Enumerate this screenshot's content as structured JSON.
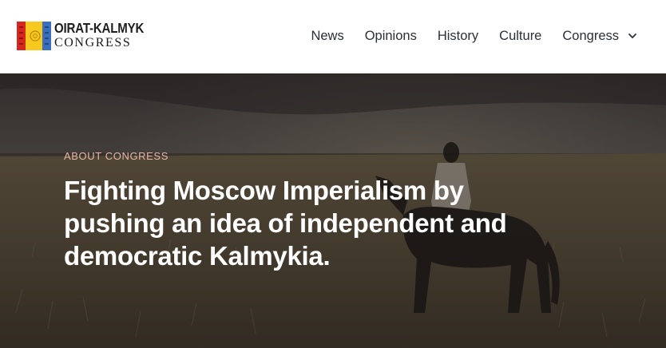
{
  "header": {
    "logo": {
      "line1": "OIRAT-KALMYK",
      "line2": "CONGRESS",
      "icon": "kalmyk-flag-icon"
    },
    "nav": {
      "items": [
        {
          "label": "News"
        },
        {
          "label": "Opinions"
        },
        {
          "label": "History"
        },
        {
          "label": "Culture"
        },
        {
          "label": "Congress",
          "icon": "chevron-down-icon"
        }
      ]
    }
  },
  "hero": {
    "eyebrow": "ABOUT CONGRESS",
    "headline": "Fighting Moscow Imperialism by pushing an idea of independent and democratic Kalmykia.",
    "colors": {
      "eyebrow": "#e8b7a8",
      "headline": "#ffffff"
    }
  },
  "brand_colors": {
    "flag_red": "#d7261e",
    "flag_yellow": "#f7c81d",
    "flag_blue": "#3a6fbf"
  }
}
